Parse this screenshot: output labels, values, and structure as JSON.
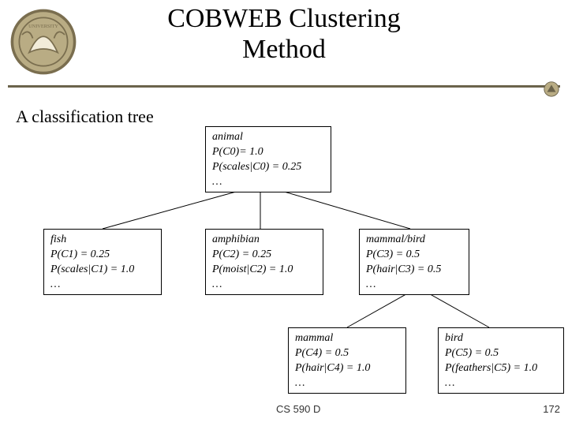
{
  "title_line1": "COBWEB Clustering",
  "title_line2": "Method",
  "subtitle": "A classification tree",
  "nodes": {
    "root": {
      "label": "animal",
      "p1": "P(C0)= 1.0",
      "p2": "P(scales|C0) = 0.25",
      "dots": "…"
    },
    "fish": {
      "label": "fish",
      "p1": "P(C1) = 0.25",
      "p2": "P(scales|C1) = 1.0",
      "dots": "…"
    },
    "amphibian": {
      "label": "amphibian",
      "p1": "P(C2) = 0.25",
      "p2": "P(moist|C2) = 1.0",
      "dots": "…"
    },
    "mammalbird": {
      "label": "mammal/bird",
      "p1": "P(C3) = 0.5",
      "p2": "P(hair|C3) = 0.5",
      "dots": "…"
    },
    "mammal": {
      "label": "mammal",
      "p1": "P(C4) = 0.5",
      "p2": "P(hair|C4) = 1.0",
      "dots": "…"
    },
    "bird": {
      "label": "bird",
      "p1": "P(C5) = 0.5",
      "p2": "P(feathers|C5) = 1.0",
      "dots": "…"
    }
  },
  "footer": {
    "course": "CS 590 D",
    "page": "172"
  },
  "colors": {
    "rule": "#6b634b",
    "logo_fill": "#b9ac84",
    "logo_stroke": "#7a6e4f"
  }
}
